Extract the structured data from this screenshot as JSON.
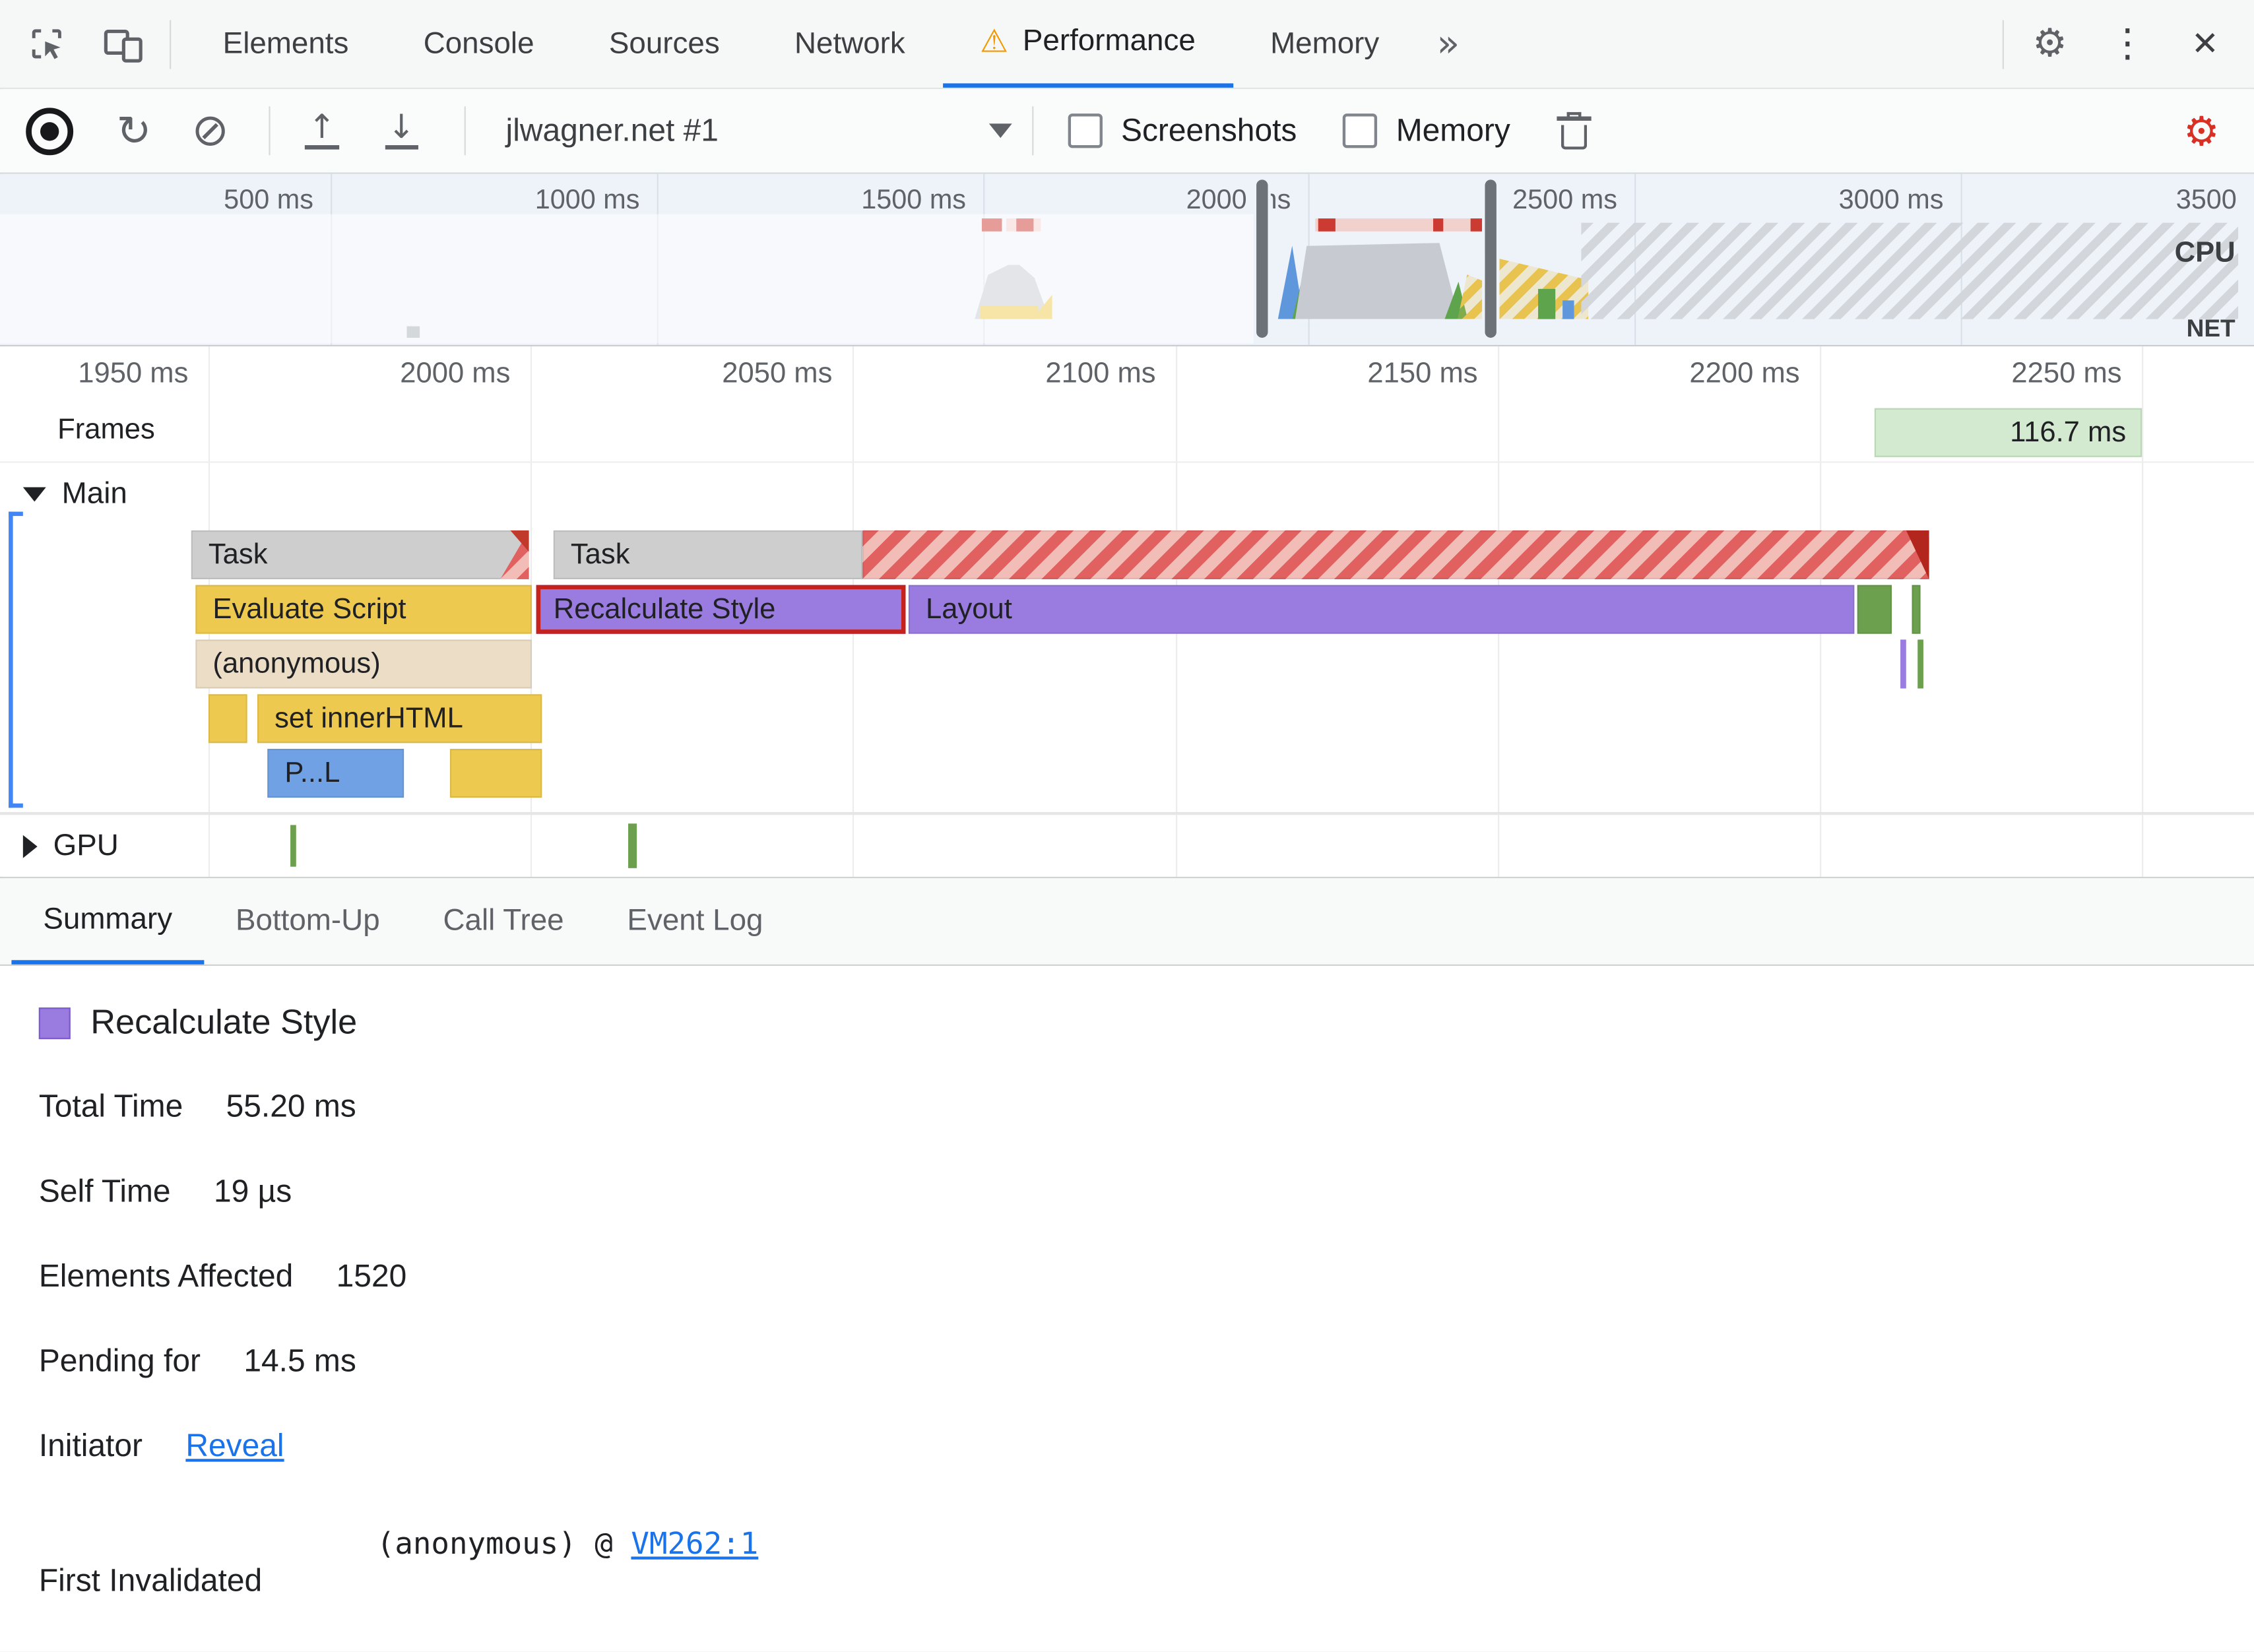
{
  "tabs": {
    "items": [
      "Elements",
      "Console",
      "Sources",
      "Network",
      "Performance",
      "Memory"
    ],
    "active": "Performance",
    "overflow": "»"
  },
  "icons": {
    "settings": "⚙",
    "more_vertical": "⋮",
    "close": "✕",
    "warning": "⚠",
    "reload": "↻",
    "block": "⊘",
    "upload": "↑",
    "download": "↓"
  },
  "toolbar": {
    "profile": "jlwagner.net #1",
    "screenshots": "Screenshots",
    "memory": "Memory"
  },
  "overview": {
    "ticks": [
      "500 ms",
      "1000 ms",
      "1500 ms",
      "2000 ms",
      "2500 ms",
      "3000 ms",
      "3500"
    ],
    "cpu": "CPU",
    "net": "NET"
  },
  "timeline": {
    "ticks": [
      "1950 ms",
      "2000 ms",
      "2050 ms",
      "2100 ms",
      "2150 ms",
      "2200 ms",
      "2250 ms"
    ],
    "frames_label": "Frames",
    "frame_duration": "116.7 ms",
    "main_label": "Main",
    "gpu_label": "GPU"
  },
  "flame": {
    "task": "Task",
    "evaluate_script": "Evaluate Script",
    "recalculate_style": "Recalculate Style",
    "layout": "Layout",
    "anonymous": "(anonymous)",
    "set_inner_html": "set innerHTML",
    "parse_truncated": "P...L"
  },
  "bottom_tabs": {
    "items": [
      "Summary",
      "Bottom-Up",
      "Call Tree",
      "Event Log"
    ],
    "active": "Summary"
  },
  "summary": {
    "title": "Recalculate Style",
    "rows": [
      {
        "label": "Total Time",
        "value": "55.20 ms"
      },
      {
        "label": "Self Time",
        "value": "19 µs"
      },
      {
        "label": "Elements Affected",
        "value": "1520"
      },
      {
        "label": "Pending for",
        "value": "14.5 ms"
      }
    ],
    "initiator": {
      "label": "Initiator",
      "link": "Reveal"
    },
    "first_invalidated": {
      "label": "First Invalidated",
      "value_prefix": "(anonymous) @ ",
      "link": "VM262:1"
    }
  },
  "colors": {
    "accent": "#1a73e8",
    "warning": "#f29900",
    "settings_alert": "#d93025",
    "scripting_yellow": "#eec94f",
    "rendering_purple": "#9a7be0",
    "painting_green": "#6ca04e",
    "loading_blue": "#6fa1e4",
    "task_gray": "#cecece",
    "frame_green": "#d3ead0",
    "highlight_red": "#c5221e"
  }
}
